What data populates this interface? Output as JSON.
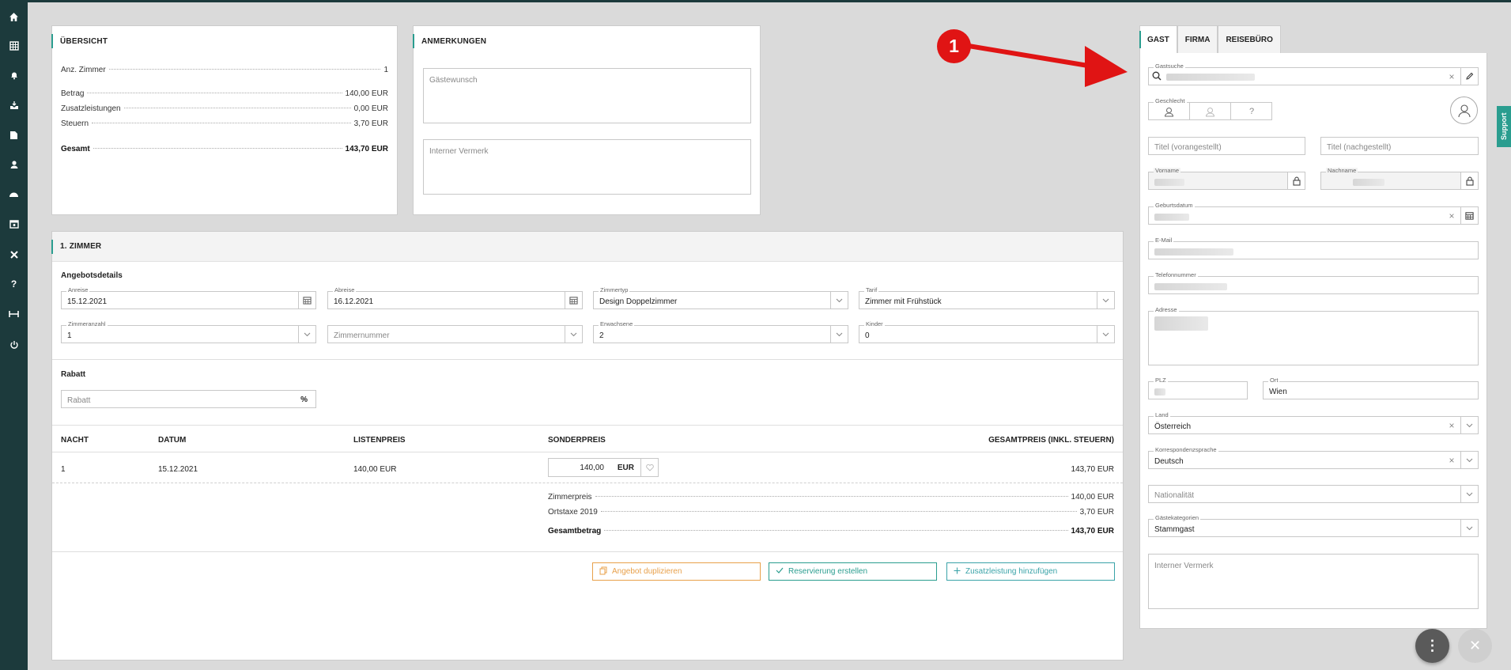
{
  "colors": {
    "sidebar": "#1c3a3c",
    "accent": "#2a9d8f",
    "orange": "#e8a04a",
    "arrow": "#e01414"
  },
  "sidebar": {
    "icons": [
      "home-icon",
      "grid-icon",
      "bell-icon",
      "inbox-icon",
      "document-icon",
      "user-icon",
      "dashboard-icon",
      "calendar-icon",
      "tools-icon",
      "help-icon",
      "bed-icon",
      "power-icon"
    ],
    "help_glyph": "?"
  },
  "overview": {
    "title": "ÜBERSICHT",
    "rows": [
      {
        "label": "Anz. Zimmer",
        "value": "1"
      },
      {
        "label": "Betrag",
        "value": "140,00 EUR"
      },
      {
        "label": "Zusatzleistungen",
        "value": "0,00 EUR"
      },
      {
        "label": "Steuern",
        "value": "3,70 EUR"
      },
      {
        "label": "Gesamt",
        "value": "143,70 EUR"
      }
    ]
  },
  "notes": {
    "title": "ANMERKUNGEN",
    "wish_placeholder": "Gästewunsch",
    "internal_placeholder": "Interner Vermerk"
  },
  "room": {
    "title": "1. ZIMMER",
    "offer_heading": "Angebotsdetails",
    "arrival": {
      "label": "Anreise",
      "value": "15.12.2021"
    },
    "departure": {
      "label": "Abreise",
      "value": "16.12.2021"
    },
    "roomtype": {
      "label": "Zimmertyp",
      "value": "Design Doppelzimmer"
    },
    "rate": {
      "label": "Tarif",
      "value": "Zimmer mit Frühstück"
    },
    "roomcount": {
      "label": "Zimmeranzahl",
      "value": "1"
    },
    "roomnumber": {
      "placeholder": "Zimmernummer"
    },
    "adults": {
      "label": "Erwachsene",
      "value": "2"
    },
    "children": {
      "label": "Kinder",
      "value": "0"
    },
    "discount_heading": "Rabatt",
    "discount": {
      "placeholder": "Rabatt",
      "suffix": "%"
    },
    "table": {
      "headers": [
        "NACHT",
        "DATUM",
        "LISTENPREIS",
        "SONDERPREIS",
        "GESAMTPREIS (INKL. STEUERN)"
      ],
      "row": {
        "night": "1",
        "date": "15.12.2021",
        "list_price": "140,00 EUR",
        "special_price": "140,00",
        "currency": "EUR",
        "total": "143,70 EUR"
      }
    },
    "summary": [
      {
        "label": "Zimmerpreis",
        "value": "140,00 EUR"
      },
      {
        "label": "Ortstaxe 2019",
        "value": "3,70 EUR"
      },
      {
        "label": "Gesamtbetrag",
        "value": "143,70 EUR"
      }
    ],
    "buttons": {
      "duplicate": "Angebot duplizieren",
      "reserve": "Reservierung erstellen",
      "addservice": "Zusatzleistung hinzufügen"
    }
  },
  "guest": {
    "tabs": [
      "GAST",
      "FIRMA",
      "REISEBÜRO"
    ],
    "search_label": "Gastsuche",
    "gender_label": "Geschlecht",
    "gender_unknown": "?",
    "title_pre": "Titel (vorangestellt)",
    "title_post": "Titel (nachgestellt)",
    "firstname_label": "Vorname",
    "lastname_label": "Nachname",
    "birthdate_label": "Geburtsdatum",
    "email_label": "E-Mail",
    "phone_label": "Telefonnummer",
    "address_label": "Adresse",
    "zip_label": "PLZ",
    "city_label": "Ort",
    "city_value": "Wien",
    "country": {
      "label": "Land",
      "value": "Österreich"
    },
    "language": {
      "label": "Korrespondenzsprache",
      "value": "Deutsch"
    },
    "nationality_placeholder": "Nationalität",
    "category": {
      "label": "Gästekategorien",
      "value": "Stammgast"
    },
    "internal_placeholder": "Interner Vermerk"
  },
  "support_tab": "Support",
  "annotation": {
    "number": "1"
  },
  "fab": {
    "menu": "⋮",
    "close": "✕"
  }
}
